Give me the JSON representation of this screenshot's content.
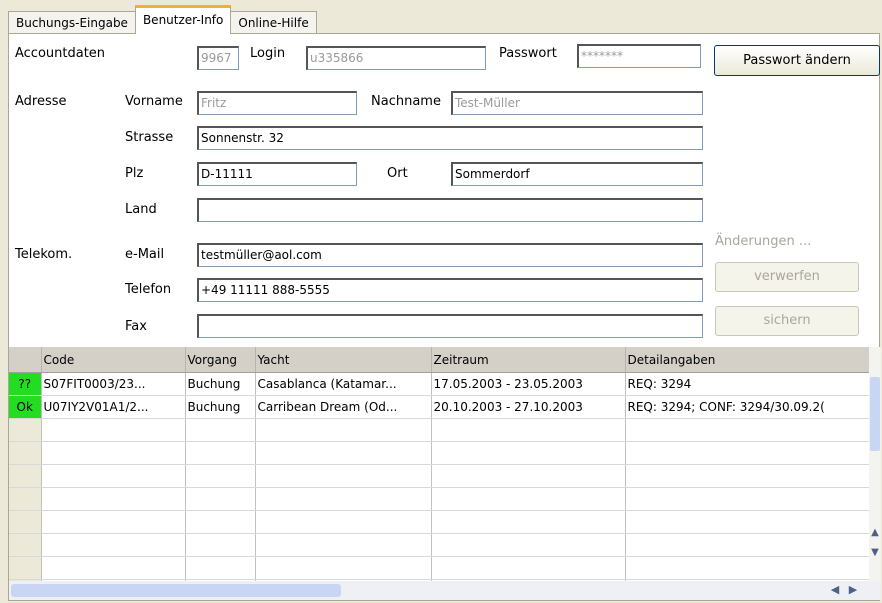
{
  "tabs": [
    {
      "label": "Buchungs-Eingabe"
    },
    {
      "label": "Benutzer-Info"
    },
    {
      "label": "Online-Hilfe"
    }
  ],
  "form": {
    "accountdaten_label": "Accountdaten",
    "account_nr": "9967",
    "login_label": "Login",
    "login_value": "u335866",
    "passwort_label": "Passwort",
    "passwort_value": "*******",
    "passwort_button": "Passwort ändern",
    "adresse_label": "Adresse",
    "vorname_label": "Vorname",
    "vorname_value": "Fritz",
    "nachname_label": "Nachname",
    "nachname_value": "Test-Müller",
    "strasse_label": "Strasse",
    "strasse_value": "Sonnenstr. 32",
    "plz_label": "Plz",
    "plz_value": "D-11111",
    "ort_label": "Ort",
    "ort_value": "Sommerdorf",
    "land_label": "Land",
    "land_value": "",
    "telekom_label": "Telekom.",
    "email_label": "e-Mail",
    "email_value": "testmüller@aol.com",
    "telefon_label": "Telefon",
    "telefon_value": "+49 11111 888-5555",
    "fax_label": "Fax",
    "fax_value": "",
    "aenderungen_label": "Änderungen ...",
    "verwerfen_button": "verwerfen",
    "sichern_button": "sichern"
  },
  "grid": {
    "columns": [
      "",
      "Code",
      "Vorgang",
      "Yacht",
      "Zeitraum",
      "Detailangaben"
    ],
    "rows": [
      {
        "status": "??",
        "code": "S07FIT0003/23...",
        "vorgang": "Buchung",
        "yacht": "Casablanca (Katamar...",
        "zeitraum": "17.05.2003 - 23.05.2003",
        "details": "REQ: 3294"
      },
      {
        "status": "Ok",
        "code": "U07IY2V01A1/2...",
        "vorgang": "Buchung",
        "yacht": "Carribean Dream (Od...",
        "zeitraum": "20.10.2003 - 27.10.2003",
        "details": "REQ: 3294; CONF: 3294/30.09.2("
      }
    ],
    "empty_rows": 9
  },
  "colors": {
    "status_ok": "#22dd22",
    "tab_highlight": "#f0b030"
  }
}
